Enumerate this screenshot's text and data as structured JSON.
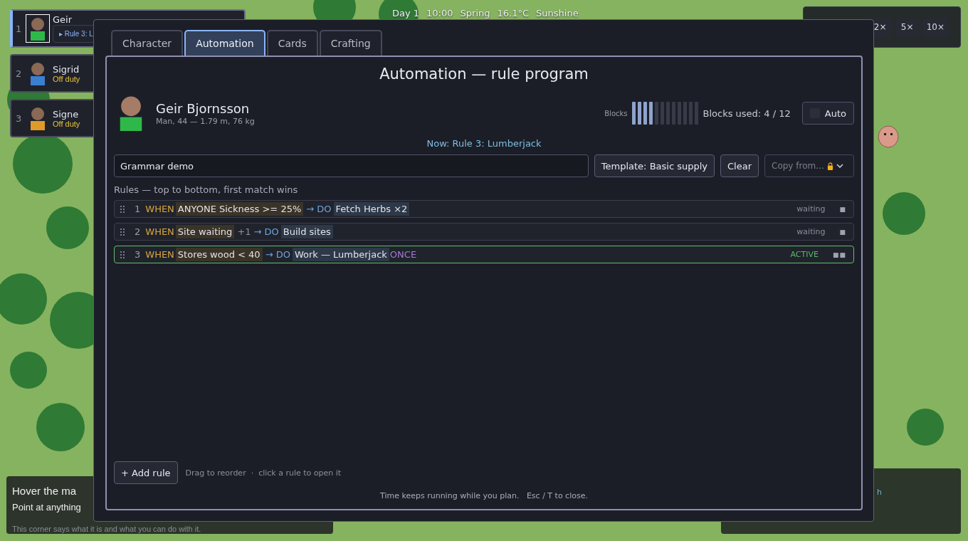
{
  "status_bar": [
    "Day 1",
    "10:00",
    "Spring",
    "16.1°C",
    "Sunshine"
  ],
  "speed_buttons": [
    "2×",
    "5×",
    "10×"
  ],
  "colonists": [
    {
      "number": "1",
      "name": "Geir",
      "status": "▸ Rule 3: L",
      "kind": "rule",
      "selected": true,
      "color": "#2fb84a"
    },
    {
      "number": "2",
      "name": "Sigrid",
      "status": "Off duty",
      "kind": "idle",
      "selected": false,
      "color": "#3a7fd0"
    },
    {
      "number": "3",
      "name": "Signe",
      "status": "Off duty",
      "kind": "idle",
      "selected": false,
      "color": "#e09a2a"
    }
  ],
  "hover_panel": {
    "title": "Hover the ma",
    "line": "Point at anything",
    "hint": "This corner says what it is and what you can do with it."
  },
  "side_panel": {
    "text": "h"
  },
  "dialog": {
    "tabs": [
      {
        "label": "Character",
        "selected": false
      },
      {
        "label": "Automation",
        "selected": true
      },
      {
        "label": "Cards",
        "selected": false
      },
      {
        "label": "Crafting",
        "selected": false
      }
    ],
    "title": "Automation — rule program",
    "character": {
      "name": "Geir Bjornsson",
      "details": "Man, 44 — 1.79 m, 76 kg",
      "color": "#2fb84a"
    },
    "blocks": {
      "label": "Blocks",
      "level": 0.3333,
      "reading": "Blocks used: 4 / 12"
    },
    "auto": {
      "label": "Auto",
      "checked": false
    },
    "now": "Now: Rule 3: Lumberjack",
    "program_name": {
      "value": "Grammar demo"
    },
    "template_button": "Template: Basic supply",
    "clear_button": "Clear",
    "copy_from": {
      "label": "Copy from…",
      "disabled": true
    },
    "rules_heading": "Rules — top to bottom, first match wins",
    "rules": [
      {
        "number": "1",
        "when": "WHEN",
        "condition": "ANYONE Sickness >= 25%",
        "do": "→ DO",
        "action": "Fetch Herbs ×2",
        "status": "waiting",
        "markers": "■",
        "active": false
      },
      {
        "number": "2",
        "when": "WHEN",
        "condition": "Site waiting",
        "modifier": "+1",
        "do": "→ DO",
        "action": "Build sites",
        "status": "waiting",
        "markers": "■",
        "active": false
      },
      {
        "number": "3",
        "when": "WHEN",
        "condition": "Stores wood < 40",
        "do": "→ DO",
        "action": "Work — Lumberjack",
        "flag": "ONCE",
        "status": "ACTIVE",
        "markers": "■■",
        "active": true
      }
    ],
    "add_button": "+ Add rule",
    "hint": "Drag to reorder  ·  click a rule to open it",
    "footer": "Time keeps running while you plan.   Esc / T to close."
  }
}
